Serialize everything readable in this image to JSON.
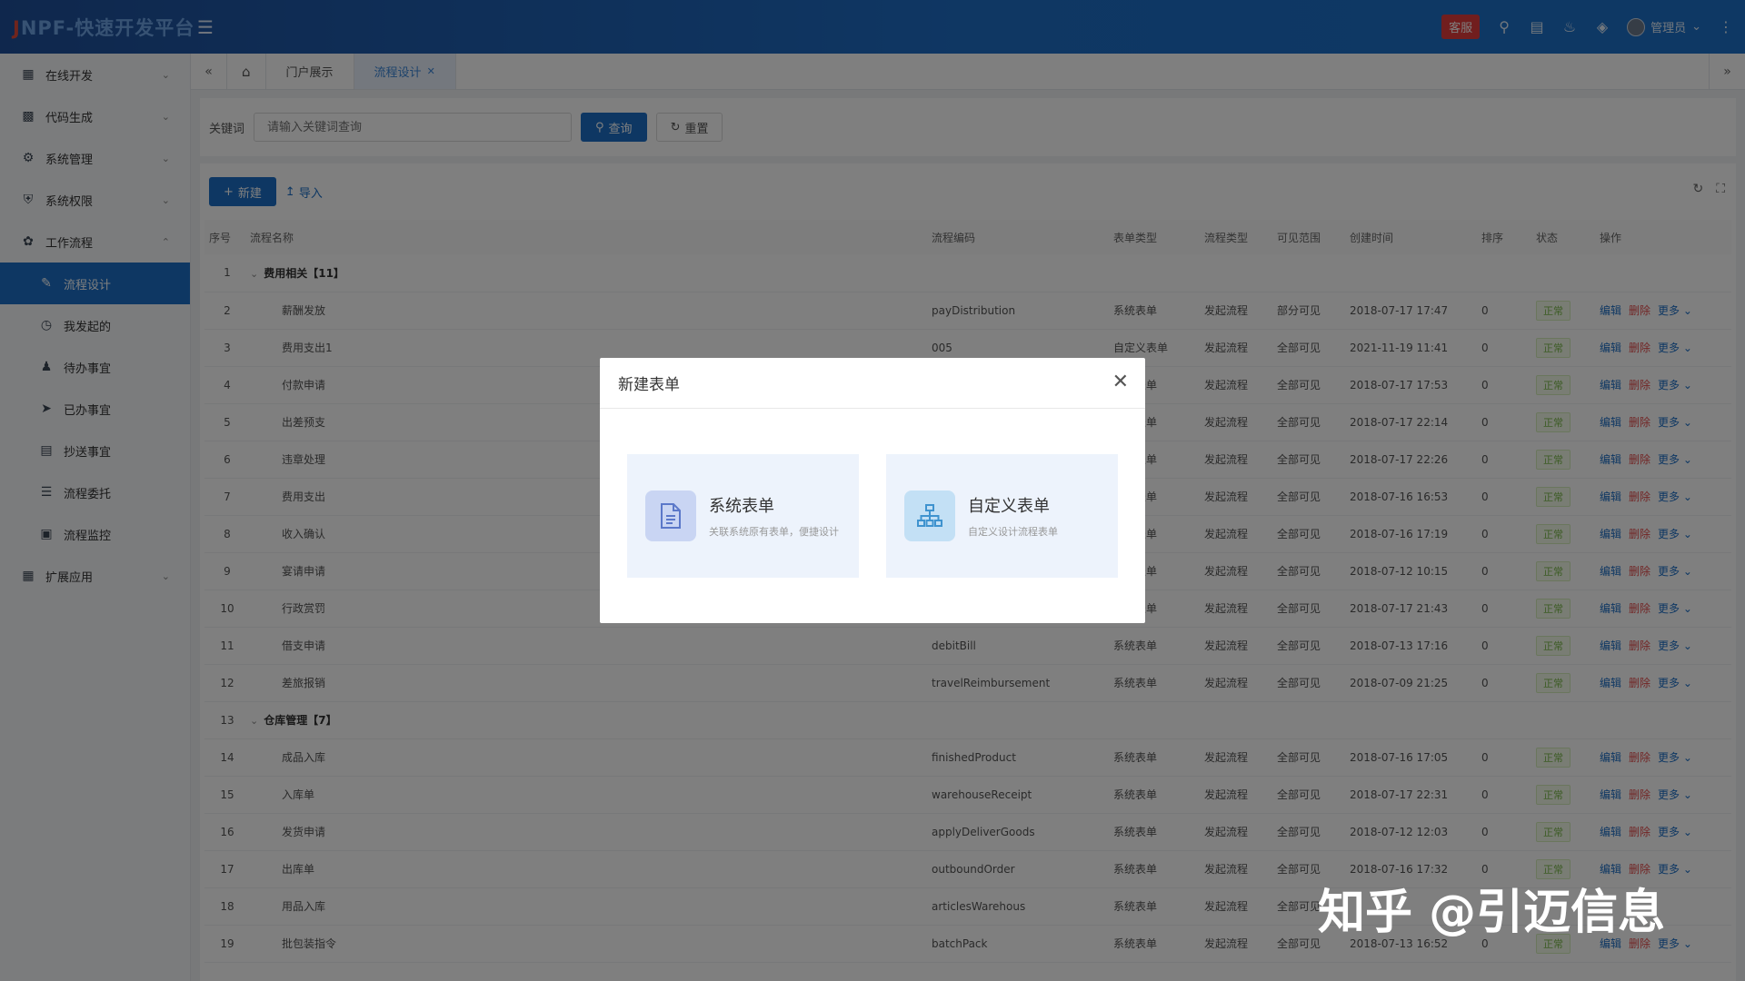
{
  "header": {
    "logo_prefix": "J",
    "logo_text": "NPF-快速开发平台",
    "kefu": "客服",
    "user": "管理员"
  },
  "sidebar": {
    "items": [
      {
        "label": "在线开发"
      },
      {
        "label": "代码生成"
      },
      {
        "label": "系统管理"
      },
      {
        "label": "系统权限"
      },
      {
        "label": "工作流程"
      },
      {
        "label": "流程设计"
      },
      {
        "label": "我发起的"
      },
      {
        "label": "待办事宜"
      },
      {
        "label": "已办事宜"
      },
      {
        "label": "抄送事宜"
      },
      {
        "label": "流程委托"
      },
      {
        "label": "流程监控"
      },
      {
        "label": "扩展应用"
      }
    ]
  },
  "tabs": {
    "portal": "门户展示",
    "design": "流程设计"
  },
  "search": {
    "label": "关键词",
    "placeholder": "请输入关键词查询",
    "query_btn": "查询",
    "reset_btn": "重置"
  },
  "toolbar": {
    "new_btn": "新建",
    "import_btn": "导入"
  },
  "table": {
    "columns": [
      "序号",
      "流程名称",
      "流程编码",
      "表单类型",
      "流程类型",
      "可见范围",
      "创建时间",
      "排序",
      "状态",
      "操作"
    ],
    "rows": [
      {
        "idx": "1",
        "group": "费用相关【11】"
      },
      {
        "idx": "2",
        "name": "薪酬发放",
        "code": "payDistribution",
        "form": "系统表单",
        "ftype": "发起流程",
        "scope": "部分可见",
        "time": "2018-07-17 17:47",
        "sort": "0",
        "status": "正常"
      },
      {
        "idx": "3",
        "name": "费用支出1",
        "code": "005",
        "form": "自定义表单",
        "ftype": "发起流程",
        "scope": "全部可见",
        "time": "2021-11-19 11:41",
        "sort": "0",
        "status": "正常"
      },
      {
        "idx": "4",
        "name": "付款申请",
        "code": "",
        "form": "系统表单",
        "ftype": "发起流程",
        "scope": "全部可见",
        "time": "2018-07-17 17:53",
        "sort": "0",
        "status": "正常"
      },
      {
        "idx": "5",
        "name": "出差预支",
        "code": "",
        "form": "系统表单",
        "ftype": "发起流程",
        "scope": "全部可见",
        "time": "2018-07-17 22:14",
        "sort": "0",
        "status": "正常"
      },
      {
        "idx": "6",
        "name": "违章处理",
        "code": "",
        "form": "系统表单",
        "ftype": "发起流程",
        "scope": "全部可见",
        "time": "2018-07-17 22:26",
        "sort": "0",
        "status": "正常"
      },
      {
        "idx": "7",
        "name": "费用支出",
        "code": "",
        "form": "系统表单",
        "ftype": "发起流程",
        "scope": "全部可见",
        "time": "2018-07-16 16:53",
        "sort": "0",
        "status": "正常"
      },
      {
        "idx": "8",
        "name": "收入确认",
        "code": "",
        "form": "系统表单",
        "ftype": "发起流程",
        "scope": "全部可见",
        "time": "2018-07-16 17:19",
        "sort": "0",
        "status": "正常"
      },
      {
        "idx": "9",
        "name": "宴请申请",
        "code": "",
        "form": "系统表单",
        "ftype": "发起流程",
        "scope": "全部可见",
        "time": "2018-07-12 10:15",
        "sort": "0",
        "status": "正常"
      },
      {
        "idx": "10",
        "name": "行政赏罚",
        "code": "",
        "form": "系统表单",
        "ftype": "发起流程",
        "scope": "全部可见",
        "time": "2018-07-17 21:43",
        "sort": "0",
        "status": "正常"
      },
      {
        "idx": "11",
        "name": "借支申请",
        "code": "debitBill",
        "form": "系统表单",
        "ftype": "发起流程",
        "scope": "全部可见",
        "time": "2018-07-13 17:16",
        "sort": "0",
        "status": "正常"
      },
      {
        "idx": "12",
        "name": "差旅报销",
        "code": "travelReimbursement",
        "form": "系统表单",
        "ftype": "发起流程",
        "scope": "全部可见",
        "time": "2018-07-09 21:25",
        "sort": "0",
        "status": "正常"
      },
      {
        "idx": "13",
        "group": "仓库管理【7】"
      },
      {
        "idx": "14",
        "name": "成品入库",
        "code": "finishedProduct",
        "form": "系统表单",
        "ftype": "发起流程",
        "scope": "全部可见",
        "time": "2018-07-16 17:05",
        "sort": "0",
        "status": "正常"
      },
      {
        "idx": "15",
        "name": "入库单",
        "code": "warehouseReceipt",
        "form": "系统表单",
        "ftype": "发起流程",
        "scope": "全部可见",
        "time": "2018-07-17 22:31",
        "sort": "0",
        "status": "正常"
      },
      {
        "idx": "16",
        "name": "发货申请",
        "code": "applyDeliverGoods",
        "form": "系统表单",
        "ftype": "发起流程",
        "scope": "全部可见",
        "time": "2018-07-12 12:03",
        "sort": "0",
        "status": "正常"
      },
      {
        "idx": "17",
        "name": "出库单",
        "code": "outboundOrder",
        "form": "系统表单",
        "ftype": "发起流程",
        "scope": "全部可见",
        "time": "2018-07-16 17:32",
        "sort": "0",
        "status": "正常"
      },
      {
        "idx": "18",
        "name": "用品入库",
        "code": "articlesWarehous",
        "form": "系统表单",
        "ftype": "发起流程",
        "scope": "全部可见",
        "time": "",
        "sort": "",
        "status": ""
      },
      {
        "idx": "19",
        "name": "批包装指令",
        "code": "batchPack",
        "form": "系统表单",
        "ftype": "发起流程",
        "scope": "全部可见",
        "time": "2018-07-13 16:52",
        "sort": "0",
        "status": "正常"
      }
    ],
    "op_edit": "编辑",
    "op_delete": "删除",
    "op_more": "更多"
  },
  "modal": {
    "title": "新建表单",
    "card1_title": "系统表单",
    "card1_desc": "关联系统原有表单，便捷设计",
    "card2_title": "自定义表单",
    "card2_desc": "自定义设计流程表单"
  },
  "watermark": {
    "text": "知乎 @引迈信息"
  }
}
